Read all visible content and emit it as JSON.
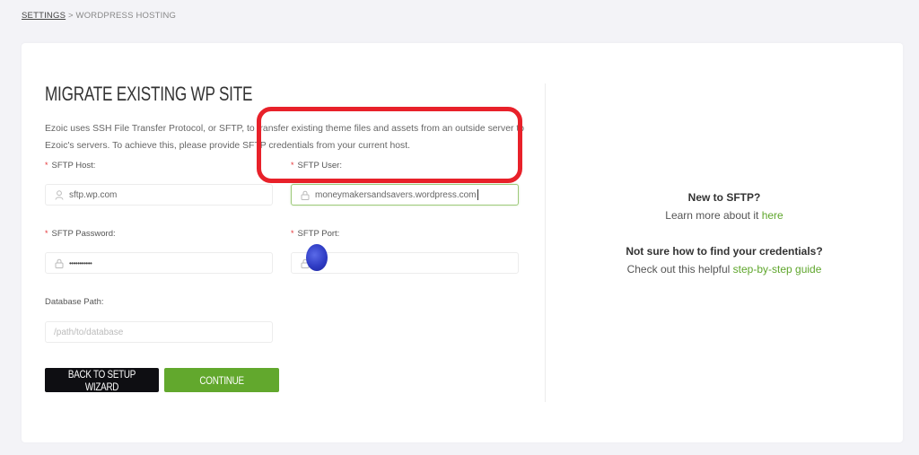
{
  "breadcrumb": {
    "parent": "SETTINGS",
    "separator": " > ",
    "current": "WORDPRESS HOSTING"
  },
  "form": {
    "title": "MIGRATE EXISTING WP SITE",
    "intro": "Ezoic uses SSH File Transfer Protocol, or SFTP, to transfer existing theme files and assets from an outside server to Ezoic's servers. To achieve this, please provide SFTP credentials from your current host.",
    "required_marker": "*",
    "fields": {
      "host": {
        "label": "SFTP Host:",
        "value": "sftp.wp.com",
        "icon": "user-icon"
      },
      "user": {
        "label": "SFTP User:",
        "value": "moneymakersandsavers.wordpress.com",
        "icon": "lock-icon",
        "focused": true
      },
      "password": {
        "label": "SFTP Password:",
        "value": "•••••••••••",
        "icon": "lock-icon"
      },
      "port": {
        "label": "SFTP Port:",
        "value": "",
        "icon": "lock-icon"
      },
      "database": {
        "label": "Database Path:",
        "placeholder": "/path/to/database",
        "value": ""
      }
    },
    "buttons": {
      "back": "BACK TO SETUP WIZARD",
      "continue": "CONTINUE"
    }
  },
  "help": {
    "q1": "New to SFTP?",
    "t1_prefix": "Learn more about it ",
    "t1_link": "here",
    "q2": "Not sure how to find your credentials?",
    "t2_prefix": "Check out this helpful ",
    "t2_link": "step-by-step guide"
  },
  "colors": {
    "accent_green": "#62a82d",
    "link_green": "#5fa62c",
    "annotation_red": "#e8212a",
    "dark_button": "#0e0e12"
  }
}
